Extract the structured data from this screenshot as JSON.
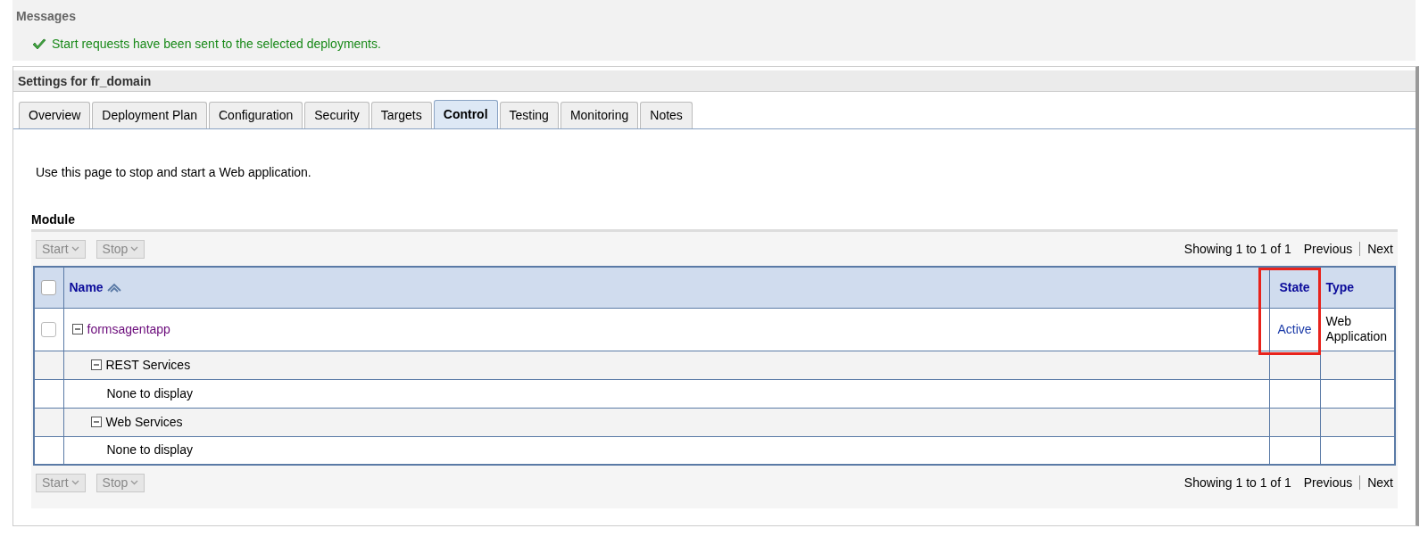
{
  "messages": {
    "title": "Messages",
    "items": [
      {
        "kind": "success",
        "text": "Start requests have been sent to the selected deployments."
      }
    ]
  },
  "settings": {
    "title": "Settings for fr_domain",
    "tabs": [
      {
        "label": "Overview",
        "selected": false
      },
      {
        "label": "Deployment Plan",
        "selected": false
      },
      {
        "label": "Configuration",
        "selected": false
      },
      {
        "label": "Security",
        "selected": false
      },
      {
        "label": "Targets",
        "selected": false
      },
      {
        "label": "Control",
        "selected": true
      },
      {
        "label": "Testing",
        "selected": false
      },
      {
        "label": "Monitoring",
        "selected": false
      },
      {
        "label": "Notes",
        "selected": false
      }
    ],
    "description": "Use this page to stop and start a Web application.",
    "module": {
      "title": "Module",
      "toolbar_top": {
        "buttons": [
          {
            "label": "Start",
            "disabled": true
          },
          {
            "label": "Stop",
            "disabled": true
          }
        ],
        "range": "Showing 1 to 1 of 1",
        "previous": "Previous",
        "next": "Next"
      },
      "table": {
        "select_all_checked": false,
        "columns": [
          {
            "label": "Name",
            "sorted": true,
            "highlighted": false
          },
          {
            "label": "State",
            "highlighted": true
          },
          {
            "label": "Type",
            "highlighted": false
          }
        ],
        "rows": [
          {
            "name": "formsagentapp",
            "checked": false,
            "expanded": true,
            "state": "Active",
            "type": "Web Application",
            "children": [
              {
                "name": "REST Services",
                "expanded": true,
                "children": [
                  {
                    "name": "None to display"
                  }
                ]
              },
              {
                "name": "Web Services",
                "expanded": true,
                "children": [
                  {
                    "name": "None to display"
                  }
                ]
              }
            ]
          }
        ]
      },
      "toolbar_bottom": {
        "buttons": [
          {
            "label": "Start",
            "disabled": true
          },
          {
            "label": "Stop",
            "disabled": true
          }
        ],
        "range": "Showing 1 to 1 of 1",
        "previous": "Previous",
        "next": "Next"
      }
    }
  }
}
